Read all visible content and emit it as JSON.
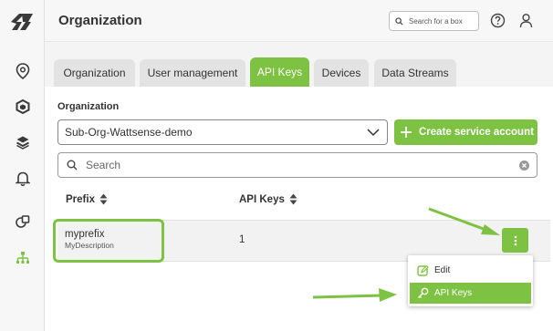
{
  "header": {
    "title": "Organization",
    "search_placeholder": "Search for a box"
  },
  "sidebar": {
    "items": [
      {
        "icon": "location-pin-icon"
      },
      {
        "icon": "box-icon"
      },
      {
        "icon": "layers-icon"
      },
      {
        "icon": "bell-icon"
      },
      {
        "icon": "devices-icon"
      },
      {
        "icon": "org-tree-icon",
        "active": true
      }
    ]
  },
  "tabs": [
    {
      "label": "Organization"
    },
    {
      "label": "User management"
    },
    {
      "label": "API Keys",
      "active": true
    },
    {
      "label": "Devices"
    },
    {
      "label": "Data Streams"
    }
  ],
  "main": {
    "org_label": "Organization",
    "org_selected": "Sub-Org-Wattsense-demo",
    "create_label": "Create service account",
    "search_placeholder": "Search",
    "columns": [
      "Prefix",
      "API Keys"
    ],
    "rows": [
      {
        "prefix": "myprefix",
        "description": "MyDescription",
        "api_keys": "1"
      }
    ]
  },
  "menu": {
    "items": [
      {
        "label": "Edit",
        "icon": "edit-icon"
      },
      {
        "label": "API Keys",
        "icon": "key-icon",
        "active": true
      }
    ]
  },
  "colors": {
    "accent": "#7dc242",
    "logo": "#3a3a3a"
  }
}
